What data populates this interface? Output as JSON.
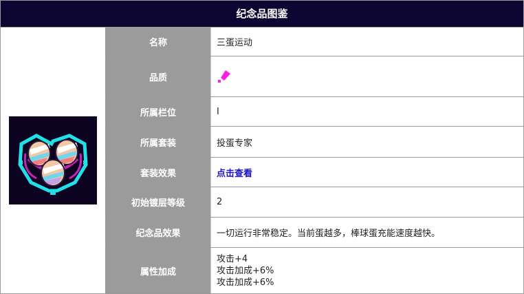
{
  "header": {
    "title": "纪念品图鉴"
  },
  "item": {
    "image_icon": "egg-trio-relic-icon"
  },
  "rows": [
    {
      "label": "名称",
      "value": "三蛋运动"
    },
    {
      "label": "品质",
      "value_icon": "quality-gem-icon"
    },
    {
      "label": "所属栏位",
      "value": "Ⅰ"
    },
    {
      "label": "所属套装",
      "value": "投蛋专家"
    },
    {
      "label": "套装效果",
      "value": "点击查看"
    },
    {
      "label": "初始镀层等级",
      "value": "2"
    },
    {
      "label": "纪念品效果",
      "value": "一切运行非常稳定。当前蛋越多，棒球蛋充能速度越快。"
    },
    {
      "label": "属性加成",
      "lines": [
        "攻击+4",
        "攻击加成+6%",
        "攻击加成+6%"
      ]
    }
  ],
  "colors": {
    "header_bg": "#0c0532",
    "label_bg": "#9b9b9b",
    "link": "#1a10c8",
    "quality": "#ff1fe0"
  }
}
